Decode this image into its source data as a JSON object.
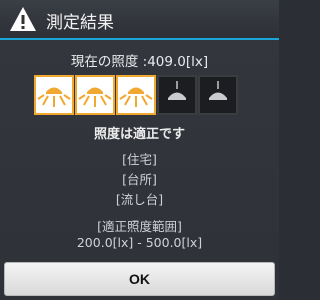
{
  "dialog": {
    "title": "測定結果",
    "title_icon": "warning-icon",
    "current_label": "現在の照度 :409.0[lx]",
    "lamps": {
      "total": 5,
      "on": 3,
      "on_icon": "lamp-on-icon",
      "off_icon": "lamp-off-icon"
    },
    "status": "照度は適正です",
    "tags": [
      "[住宅]",
      "[台所]",
      "[流し台]"
    ],
    "range_title": "[適正照度範囲]",
    "range_value": "200.0[lx] - 500.0[lx]",
    "ok_label": "OK"
  },
  "colors": {
    "accent": "#1aa6d8",
    "lamp_border": "#f0a830",
    "lamp_bg_on": "#ffffff",
    "lamp_bg_off": "#1c1d20",
    "background": "#30343a"
  }
}
